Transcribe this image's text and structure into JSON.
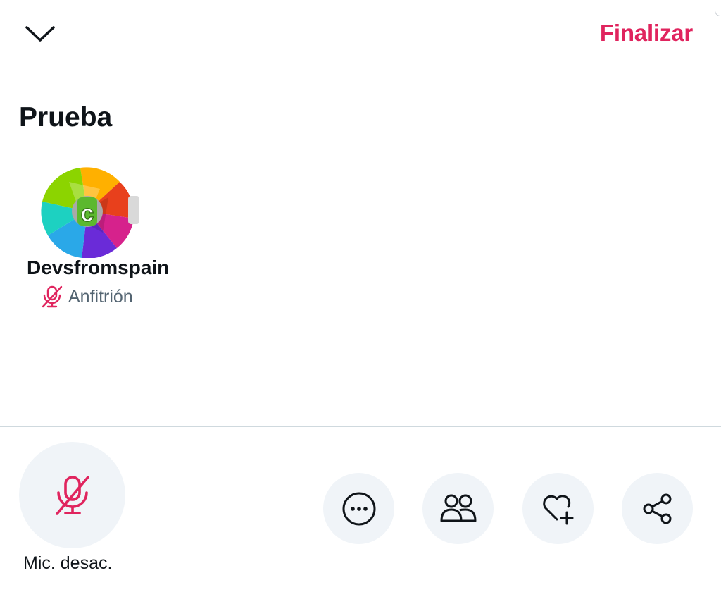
{
  "header": {
    "collapse_icon": "chevron-down-icon",
    "end_label": "Finalizar"
  },
  "space": {
    "title": "Prueba"
  },
  "participants": [
    {
      "name": "Devsfromspain",
      "role": "Anfitrión",
      "role_icon": "mic-off-icon",
      "avatar_icon": "aperture-logo"
    }
  ],
  "controls": {
    "mic_label": "Mic. desac.",
    "mic_icon": "mic-off-icon",
    "actions": [
      {
        "icon": "more-icon"
      },
      {
        "icon": "people-icon"
      },
      {
        "icon": "heart-plus-icon"
      },
      {
        "icon": "share-icon"
      }
    ]
  },
  "colors": {
    "accent": "#e0245e",
    "text": "#0f1419",
    "secondary_text": "#536471",
    "button_bg": "#f0f4f8",
    "divider": "#cfd9de"
  }
}
